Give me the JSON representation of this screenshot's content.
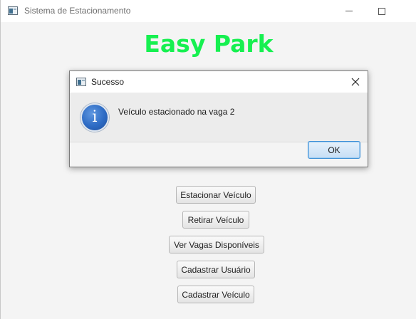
{
  "window": {
    "title": "Sistema de Estacionamento",
    "heading": "Easy Park",
    "heading_color": "#16f050",
    "controls": {
      "minimize": "minimize-icon",
      "maximize": "maximize-icon"
    }
  },
  "menu": {
    "buttons": [
      {
        "label": "Estacionar Veículo"
      },
      {
        "label": "Retirar Veículo"
      },
      {
        "label": "Ver Vagas Disponíveis"
      },
      {
        "label": "Cadastrar Usuário"
      },
      {
        "label": "Cadastrar Veículo"
      }
    ]
  },
  "dialog": {
    "title": "Sucesso",
    "icon": "info-icon",
    "icon_glyph": "i",
    "message": "Veículo estacionado na vaga 2",
    "ok_label": "OK",
    "accent_color": "#3c8fd6"
  }
}
